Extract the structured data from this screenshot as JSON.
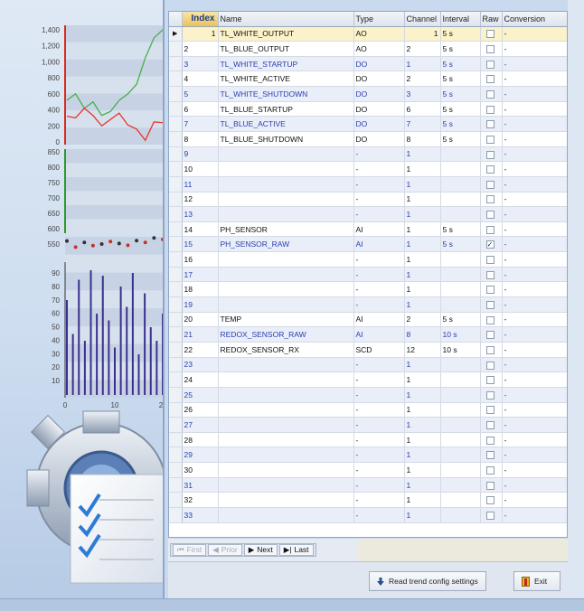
{
  "grid": {
    "columns": [
      "Index",
      "Name",
      "Type",
      "Channel",
      "Interval",
      "Raw",
      "Conversion"
    ],
    "rows": [
      {
        "index": "1",
        "name": "TL_WHITE_OUTPUT",
        "type": "AO",
        "channel": "1",
        "interval": "5 s",
        "raw": false,
        "conversion": "-"
      },
      {
        "index": "2",
        "name": "TL_BLUE_OUTPUT",
        "type": "AO",
        "channel": "2",
        "interval": "5 s",
        "raw": false,
        "conversion": "-"
      },
      {
        "index": "3",
        "name": "TL_WHITE_STARTUP",
        "type": "DO",
        "channel": "1",
        "interval": "5 s",
        "raw": false,
        "conversion": "-"
      },
      {
        "index": "4",
        "name": "TL_WHITE_ACTIVE",
        "type": "DO",
        "channel": "2",
        "interval": "5 s",
        "raw": false,
        "conversion": "-"
      },
      {
        "index": "5",
        "name": "TL_WHITE_SHUTDOWN",
        "type": "DO",
        "channel": "3",
        "interval": "5 s",
        "raw": false,
        "conversion": "-"
      },
      {
        "index": "6",
        "name": "TL_BLUE_STARTUP",
        "type": "DO",
        "channel": "6",
        "interval": "5 s",
        "raw": false,
        "conversion": "-"
      },
      {
        "index": "7",
        "name": "TL_BLUE_ACTIVE",
        "type": "DO",
        "channel": "7",
        "interval": "5 s",
        "raw": false,
        "conversion": "-"
      },
      {
        "index": "8",
        "name": "TL_BLUE_SHUTDOWN",
        "type": "DO",
        "channel": "8",
        "interval": "5 s",
        "raw": false,
        "conversion": "-"
      },
      {
        "index": "9",
        "name": "",
        "type": "-",
        "channel": "1",
        "interval": "",
        "raw": false,
        "conversion": "-"
      },
      {
        "index": "10",
        "name": "",
        "type": "-",
        "channel": "1",
        "interval": "",
        "raw": false,
        "conversion": "-"
      },
      {
        "index": "11",
        "name": "",
        "type": "-",
        "channel": "1",
        "interval": "",
        "raw": false,
        "conversion": "-"
      },
      {
        "index": "12",
        "name": "",
        "type": "-",
        "channel": "1",
        "interval": "",
        "raw": false,
        "conversion": "-"
      },
      {
        "index": "13",
        "name": "",
        "type": "-",
        "channel": "1",
        "interval": "",
        "raw": false,
        "conversion": "-"
      },
      {
        "index": "14",
        "name": "PH_SENSOR",
        "type": "AI",
        "channel": "1",
        "interval": "5 s",
        "raw": false,
        "conversion": "-"
      },
      {
        "index": "15",
        "name": "PH_SENSOR_RAW",
        "type": "AI",
        "channel": "1",
        "interval": "5 s",
        "raw": true,
        "conversion": "-"
      },
      {
        "index": "16",
        "name": "",
        "type": "-",
        "channel": "1",
        "interval": "",
        "raw": false,
        "conversion": "-"
      },
      {
        "index": "17",
        "name": "",
        "type": "-",
        "channel": "1",
        "interval": "",
        "raw": false,
        "conversion": "-"
      },
      {
        "index": "18",
        "name": "",
        "type": "-",
        "channel": "1",
        "interval": "",
        "raw": false,
        "conversion": "-"
      },
      {
        "index": "19",
        "name": "",
        "type": "-",
        "channel": "1",
        "interval": "",
        "raw": false,
        "conversion": "-"
      },
      {
        "index": "20",
        "name": "TEMP",
        "type": "AI",
        "channel": "2",
        "interval": "5 s",
        "raw": false,
        "conversion": "-"
      },
      {
        "index": "21",
        "name": "REDOX_SENSOR_RAW",
        "type": "AI",
        "channel": "8",
        "interval": "10 s",
        "raw": false,
        "conversion": "-"
      },
      {
        "index": "22",
        "name": "REDOX_SENSOR_RX",
        "type": "SCD",
        "channel": "12",
        "interval": "10 s",
        "raw": false,
        "conversion": "-"
      },
      {
        "index": "23",
        "name": "",
        "type": "-",
        "channel": "1",
        "interval": "",
        "raw": false,
        "conversion": "-"
      },
      {
        "index": "24",
        "name": "",
        "type": "-",
        "channel": "1",
        "interval": "",
        "raw": false,
        "conversion": "-"
      },
      {
        "index": "25",
        "name": "",
        "type": "-",
        "channel": "1",
        "interval": "",
        "raw": false,
        "conversion": "-"
      },
      {
        "index": "26",
        "name": "",
        "type": "-",
        "channel": "1",
        "interval": "",
        "raw": false,
        "conversion": "-"
      },
      {
        "index": "27",
        "name": "",
        "type": "-",
        "channel": "1",
        "interval": "",
        "raw": false,
        "conversion": "-"
      },
      {
        "index": "28",
        "name": "",
        "type": "-",
        "channel": "1",
        "interval": "",
        "raw": false,
        "conversion": "-"
      },
      {
        "index": "29",
        "name": "",
        "type": "-",
        "channel": "1",
        "interval": "",
        "raw": false,
        "conversion": "-"
      },
      {
        "index": "30",
        "name": "",
        "type": "-",
        "channel": "1",
        "interval": "",
        "raw": false,
        "conversion": "-"
      },
      {
        "index": "31",
        "name": "",
        "type": "-",
        "channel": "1",
        "interval": "",
        "raw": false,
        "conversion": "-"
      },
      {
        "index": "32",
        "name": "",
        "type": "-",
        "channel": "1",
        "interval": "",
        "raw": false,
        "conversion": "-"
      },
      {
        "index": "33",
        "name": "",
        "type": "-",
        "channel": "1",
        "interval": "",
        "raw": false,
        "conversion": "-"
      }
    ],
    "current_row_marker": "▶"
  },
  "navigation": {
    "first_label": "First",
    "prior_label": "Prior",
    "next_label": "Next",
    "last_label": "Last"
  },
  "actions": {
    "read_label": "Read trend config settings",
    "exit_label": "Exit"
  },
  "side_graphic": {
    "chart_top_ticks": [
      "1,400",
      "1,200",
      "1,000",
      "800",
      "600",
      "400",
      "200",
      "0"
    ],
    "chart_mid_ticks": [
      "850",
      "800",
      "750",
      "700",
      "650",
      "600",
      "550"
    ],
    "chart_bottom_ticks": [
      "90",
      "80",
      "70",
      "60",
      "50",
      "40",
      "30",
      "20",
      "10"
    ],
    "chart_x_ticks": [
      "0",
      "10",
      "2"
    ],
    "green_line": [
      520,
      600,
      420,
      500,
      330,
      380,
      520,
      600,
      720,
      1050,
      1300,
      1400
    ],
    "red_line": [
      320,
      300,
      420,
      330,
      200,
      280,
      360,
      210,
      160,
      20,
      250,
      240
    ],
    "dots": [
      560,
      540,
      555,
      545,
      550,
      558,
      552,
      546,
      561,
      555,
      570,
      565
    ],
    "bars": [
      70,
      45,
      85,
      40,
      92,
      60,
      88,
      55,
      35,
      80,
      65,
      90,
      30,
      75,
      50,
      40,
      60
    ],
    "colors": {
      "green": "#47b14a",
      "red": "#e6372a",
      "bars": "#3a2f8c",
      "axis_red": "#d62b20",
      "axis_green": "#2a9a2a"
    }
  }
}
